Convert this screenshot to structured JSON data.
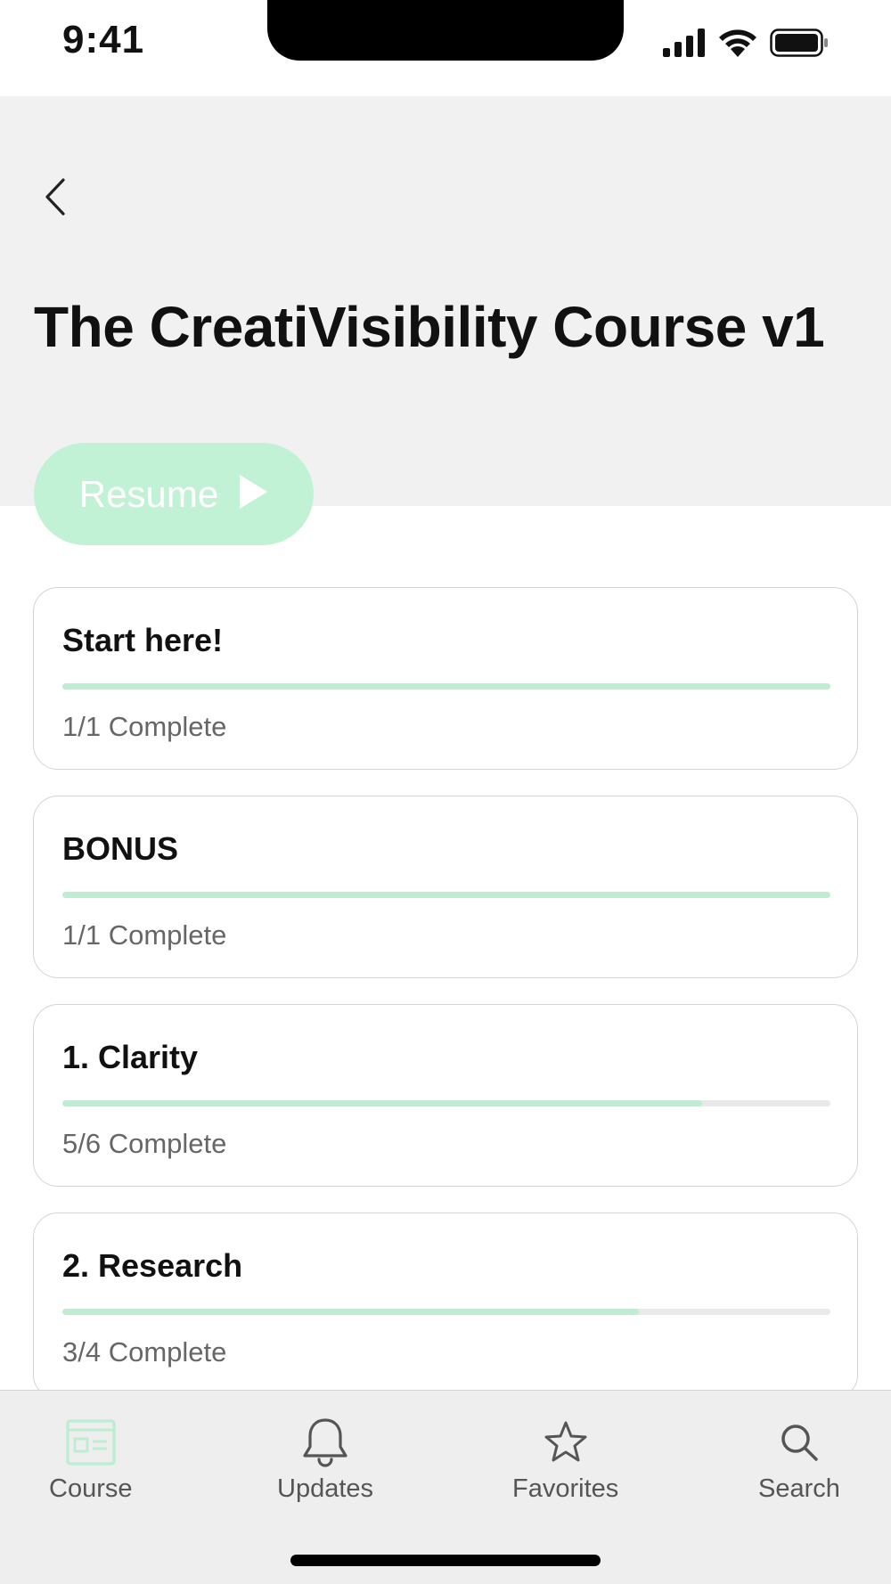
{
  "status_bar": {
    "time": "9:41",
    "icons": [
      "cellular-signal-icon",
      "wifi-icon",
      "battery-icon"
    ]
  },
  "header": {
    "back_icon": "chevron-left-icon",
    "title": "The CreatiVisibility Course v1"
  },
  "resume": {
    "label": "Resume",
    "icon": "play-icon",
    "color": "#c2f2d6"
  },
  "sections": [
    {
      "title": "Start here!",
      "status": "1/1 Complete",
      "completed": 1,
      "total": 1
    },
    {
      "title": "BONUS",
      "status": "1/1 Complete",
      "completed": 1,
      "total": 1
    },
    {
      "title": "1. Clarity",
      "status": "5/6 Complete",
      "completed": 5,
      "total": 6
    },
    {
      "title": "2. Research",
      "status": "3/4 Complete",
      "completed": 3,
      "total": 4
    }
  ],
  "tabs": [
    {
      "label": "Course",
      "icon": "course-icon",
      "active": true
    },
    {
      "label": "Updates",
      "icon": "bell-icon",
      "active": false
    },
    {
      "label": "Favorites",
      "icon": "star-icon",
      "active": false
    },
    {
      "label": "Search",
      "icon": "search-icon",
      "active": false
    }
  ],
  "colors": {
    "accent": "#bdeed2",
    "header_bg": "#f1f1f1",
    "tabbar_bg": "#eeeeee"
  }
}
